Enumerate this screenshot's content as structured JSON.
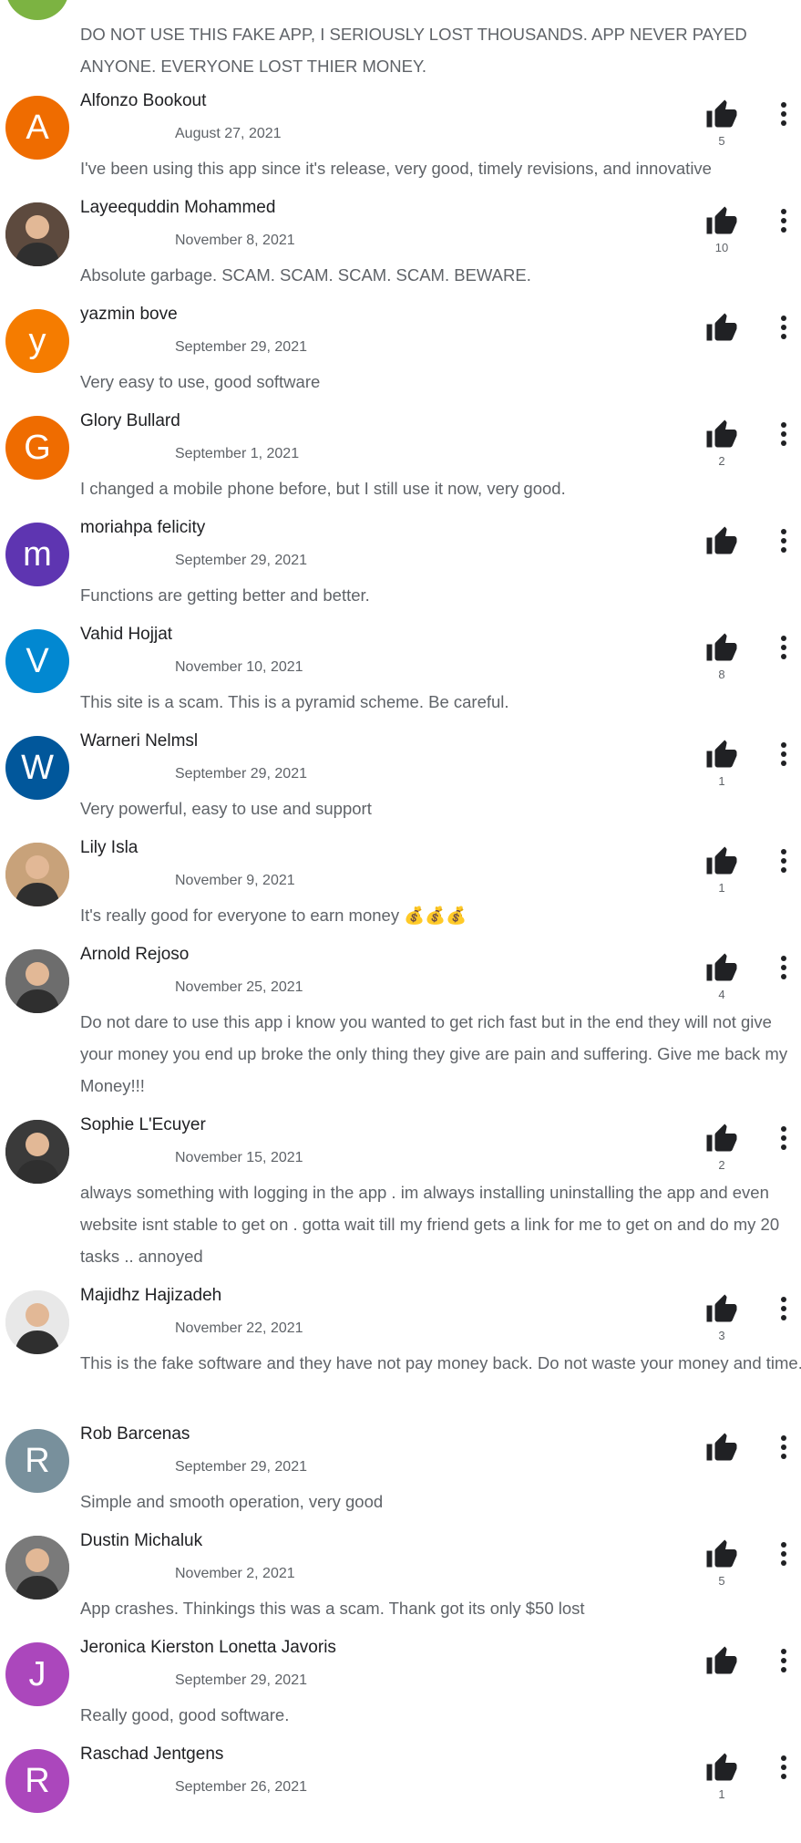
{
  "colors": {
    "like_icon": "#202124",
    "more_icon": "#202124",
    "partial_avatar": "#7cb342"
  },
  "top_review": {
    "text": "DO NOT USE THIS FAKE APP, I SERIOUSLY LOST THOUSANDS. APP NEVER PAYED ANYONE. EVERYONE LOST THIER MONEY."
  },
  "reviews": [
    {
      "name": "Alfonzo Bookout",
      "date": "August 27, 2021",
      "likes": "5",
      "text": "I've been using this app since it's release, very good, timely revisions, and innovative",
      "avatar_letter": "A",
      "avatar_color": "#ef6c00",
      "avatar_icon": ""
    },
    {
      "name": "Layeequddin Mohammed",
      "date": "November 8, 2021",
      "likes": "10",
      "text": "Absolute garbage. SCAM. SCAM. SCAM. SCAM. BEWARE.",
      "avatar_letter": "",
      "avatar_color": "#5d4a3e",
      "avatar_icon": "photo-avatar-icon"
    },
    {
      "name": "yazmin bove",
      "date": "September 29, 2021",
      "likes": "",
      "text": "Very easy to use, good software",
      "avatar_letter": "y",
      "avatar_color": "#f57c00",
      "avatar_icon": ""
    },
    {
      "name": "Glory Bullard",
      "date": "September 1, 2021",
      "likes": "2",
      "text": "I changed a mobile phone before, but I still use it now, very good.",
      "avatar_letter": "G",
      "avatar_color": "#ef6c00",
      "avatar_icon": ""
    },
    {
      "name": "moriahpa felicity",
      "date": "September 29, 2021",
      "likes": "",
      "text": "Functions are getting better and better.",
      "avatar_letter": "m",
      "avatar_color": "#5e35b1",
      "avatar_icon": ""
    },
    {
      "name": "Vahid Hojjat",
      "date": "November 10, 2021",
      "likes": "8",
      "text": "This site is a scam. This is a pyramid scheme. Be careful.",
      "avatar_letter": "V",
      "avatar_color": "#0288d1",
      "avatar_icon": ""
    },
    {
      "name": "Warneri Nelmsl",
      "date": "September 29, 2021",
      "likes": "1",
      "text": "Very powerful, easy to use and support",
      "avatar_letter": "W",
      "avatar_color": "#01579b",
      "avatar_icon": ""
    },
    {
      "name": "Lily Isla",
      "date": "November 9, 2021",
      "likes": "1",
      "text": "It's really good for everyone to earn money 💰💰💰",
      "avatar_letter": "",
      "avatar_color": "#c8a27a",
      "avatar_icon": "photo-avatar-icon"
    },
    {
      "name": "Arnold Rejoso",
      "date": "November 25, 2021",
      "likes": "4",
      "text": "Do not dare to use this app i know you wanted to get rich fast but in the end they will not give your money you end up broke the only thing they give are pain and suffering. Give me back my Money!!!",
      "avatar_letter": "",
      "avatar_color": "#6d6d6d",
      "avatar_icon": "photo-avatar-icon"
    },
    {
      "name": "Sophie L'Ecuyer",
      "date": "November 15, 2021",
      "likes": "2",
      "text": "always something with logging in the app . im always installing uninstalling the app and even website isnt stable to get on . gotta wait till my friend gets a link for me to get on and do my 20 tasks .. annoyed",
      "avatar_letter": "",
      "avatar_color": "#3a3a3a",
      "avatar_icon": "photo-avatar-icon"
    },
    {
      "name": "Majidhz Hajizadeh",
      "date": "November 22, 2021",
      "likes": "3",
      "text": "This is the fake software and they have not pay money back. Do not waste your money and time.",
      "avatar_letter": "",
      "avatar_color": "#e8e8e8",
      "avatar_icon": "photo-avatar-icon"
    },
    {
      "name": "Rob Barcenas",
      "date": "September 29, 2021",
      "likes": "",
      "text": "Simple and smooth operation, very good",
      "avatar_letter": "R",
      "avatar_color": "#78909c",
      "avatar_icon": ""
    },
    {
      "name": "Dustin Michaluk",
      "date": "November 2, 2021",
      "likes": "5",
      "text": "App crashes. Thinkings this was a scam. Thank got its only $50 lost",
      "avatar_letter": "",
      "avatar_color": "#7a7a7a",
      "avatar_icon": "photo-avatar-icon"
    },
    {
      "name": "Jeronica Kierston Lonetta Javoris",
      "date": "September 29, 2021",
      "likes": "",
      "text": "Really good, good software.",
      "avatar_letter": "J",
      "avatar_color": "#ab47bc",
      "avatar_icon": ""
    },
    {
      "name": "Raschad Jentgens",
      "date": "September 26, 2021",
      "likes": "1",
      "text": "",
      "avatar_letter": "R",
      "avatar_color": "#ab47bc",
      "avatar_icon": ""
    }
  ]
}
